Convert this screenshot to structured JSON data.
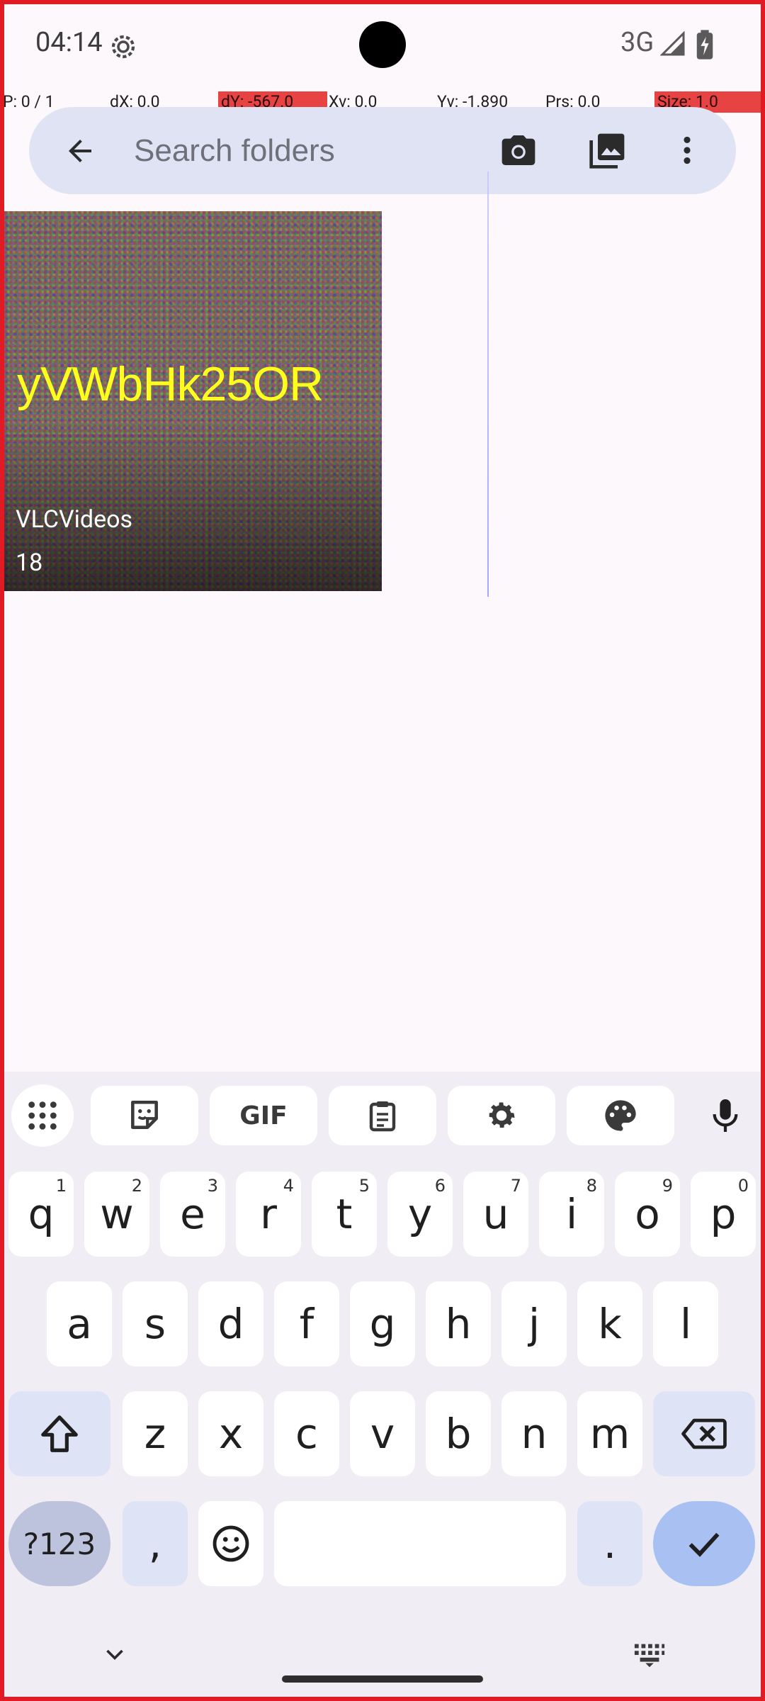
{
  "status_bar": {
    "time": "04:14",
    "network": "3G",
    "icons": [
      "settings-gear-icon",
      "signal-icon",
      "battery-charging-icon"
    ]
  },
  "pointer_info": {
    "p": "P: 0 / 1",
    "dx": "dX: 0.0",
    "dy": "dY: -567.0",
    "xv": "Xv: 0.0",
    "yv": "Yv: -1.890",
    "prs": "Prs: 0.0",
    "size": "Size: 1.0"
  },
  "search": {
    "placeholder": "Search folders",
    "icons": [
      "back-arrow-icon",
      "camera-icon",
      "gallery-icon",
      "more-vert-icon"
    ]
  },
  "folders": [
    {
      "thumbnail_text": "yVWbHk25OR",
      "name": "VLCVideos",
      "count": "18"
    }
  ],
  "keyboard": {
    "toolbar_icons": [
      "apps-grid-icon",
      "sticker-icon",
      "gif-icon",
      "clipboard-icon",
      "settings-icon",
      "palette-icon",
      "mic-icon"
    ],
    "gif_label": "GIF",
    "row1": [
      {
        "key": "q",
        "hint": "1"
      },
      {
        "key": "w",
        "hint": "2"
      },
      {
        "key": "e",
        "hint": "3"
      },
      {
        "key": "r",
        "hint": "4"
      },
      {
        "key": "t",
        "hint": "5"
      },
      {
        "key": "y",
        "hint": "6"
      },
      {
        "key": "u",
        "hint": "7"
      },
      {
        "key": "i",
        "hint": "8"
      },
      {
        "key": "o",
        "hint": "9"
      },
      {
        "key": "p",
        "hint": "0"
      }
    ],
    "row2": [
      "a",
      "s",
      "d",
      "f",
      "g",
      "h",
      "j",
      "k",
      "l"
    ],
    "row3": [
      "z",
      "x",
      "c",
      "v",
      "b",
      "n",
      "m"
    ],
    "symbols_label": "?123",
    "comma": ",",
    "period": ".",
    "accent_color": "#a9c0f2"
  },
  "nav": {
    "icons": [
      "hide-keyboard-chevron-icon",
      "keyboard-switch-icon"
    ]
  }
}
